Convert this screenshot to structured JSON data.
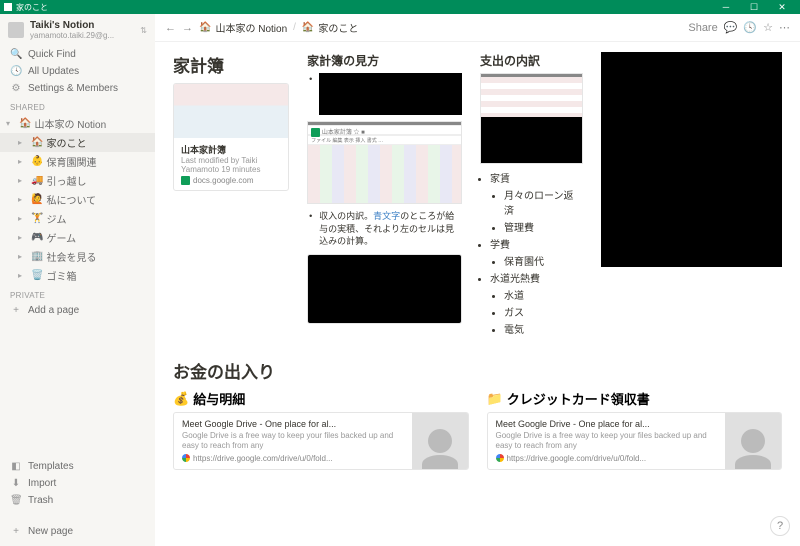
{
  "window": {
    "title": "家のこと"
  },
  "workspace": {
    "name": "Taiki's Notion",
    "email": "yamamoto.taiki.29@g..."
  },
  "nav": {
    "quickFind": "Quick Find",
    "allUpdates": "All Updates",
    "settings": "Settings & Members"
  },
  "sections": {
    "shared": "SHARED",
    "private": "PRIVATE"
  },
  "tree": {
    "root": "山本家の Notion",
    "items": [
      {
        "emoji": "🏠",
        "label": "家のこと"
      },
      {
        "emoji": "👶",
        "label": "保育園関連"
      },
      {
        "emoji": "🚚",
        "label": "引っ越し"
      },
      {
        "emoji": "🙋",
        "label": "私について"
      },
      {
        "emoji": "🏋️",
        "label": "ジム"
      },
      {
        "emoji": "🎮",
        "label": "ゲーム"
      },
      {
        "emoji": "🏢",
        "label": "社会を見る"
      },
      {
        "emoji": "🗑️",
        "label": "ゴミ箱"
      }
    ]
  },
  "sidebarBottom": {
    "addPage": "Add a page",
    "templates": "Templates",
    "import": "Import",
    "trash": "Trash",
    "newPage": "New page"
  },
  "breadcrumb": {
    "parent": "山本家の Notion",
    "current": "家のこと"
  },
  "topbar": {
    "share": "Share"
  },
  "page": {
    "h_kakeibo": "家計簿",
    "card1": {
      "title": "山本家計簿",
      "sub": "Last modified by Taiki Yamamoto 19 minutes",
      "src": "docs.google.com",
      "sheetLabel": "山本家計簿"
    },
    "h_howto": "家計簿の見方",
    "note1_a": "収入の内訳。",
    "note1_link": "青文字",
    "note1_b": "のところが給与の実積、それより左のセルは見込みの計算。",
    "h_expense": "支出の内訳",
    "list": {
      "a": "家賃",
      "a1": "月々のローン返済",
      "a2": "管理費",
      "b": "学費",
      "b1": "保育園代",
      "c": "水道光熱費",
      "c1": "水道",
      "c2": "ガス",
      "c3": "電気"
    },
    "h_money": "お金の出入り",
    "h_salary": "給与明細",
    "h_credit": "クレジットカード領収書",
    "drive": {
      "title": "Meet Google Drive - One place for al...",
      "desc": "Google Drive is a free way to keep your files backed up and easy to reach from any",
      "url": "https://drive.google.com/drive/u/0/fold..."
    }
  }
}
